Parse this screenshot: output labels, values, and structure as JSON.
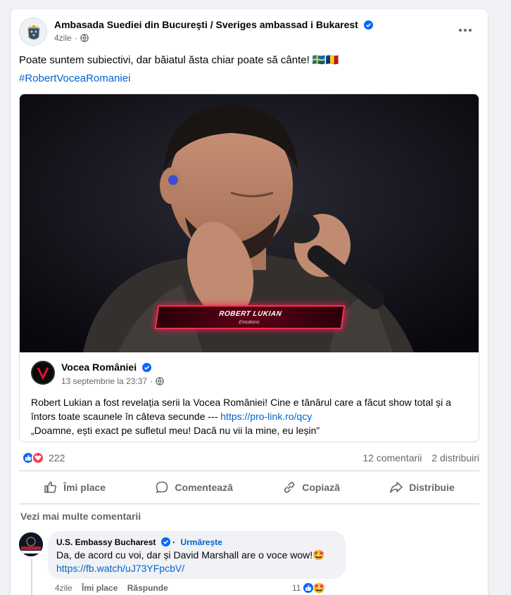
{
  "post": {
    "author": "Ambasada Suediei din Bucureşti / Sveriges ambassad i Bukarest",
    "time": "4zile",
    "text": "Poate suntem subiectivi, dar băiatul ăsta chiar poate să cânte! 🇸🇪🇷🇴",
    "hashtag": "#RobertVoceaRomaniei",
    "more_icon": "more-horizontal-icon"
  },
  "shared": {
    "video_name_title": "ROBERT LUKIAN",
    "video_name_sub": "Emotions",
    "author": "Vocea României",
    "time": "13 septembrie la 23:37",
    "dot": "·",
    "text": "Robert Lukian a fost revelația serii la Vocea României! Cine e tânărul care a făcut show total și a întors toate scaunele în câteva secunde --- ",
    "link": "https://pro-link.ro/qcy",
    "quote": "„Doamne, ești exact pe sufletul meu! Dacă nu vii la mine, eu leșin”"
  },
  "stats": {
    "reactions": "222",
    "comments": "12 comentarii",
    "shares": "2 distribuiri"
  },
  "actions": {
    "like": "Îmi place",
    "comment": "Comentează",
    "copy": "Copiază",
    "share": "Distribuie"
  },
  "comments_link": "Vezi mai multe comentarii",
  "comment": {
    "author": "U.S. Embassy Bucharest",
    "follow": "Urmărește",
    "text": "Da, de acord cu voi, dar și David Marshall are o voce wow!🤩",
    "link": "https://fb.watch/uJ73YFpcbV/",
    "time": "4zile",
    "like": "Îmi place",
    "reply": "Răspunde",
    "reactions": "11"
  },
  "colors": {
    "link": "#0064d1",
    "verified": "#0866ff",
    "like_react": "#0866ff",
    "love_react": "#f33e58"
  }
}
